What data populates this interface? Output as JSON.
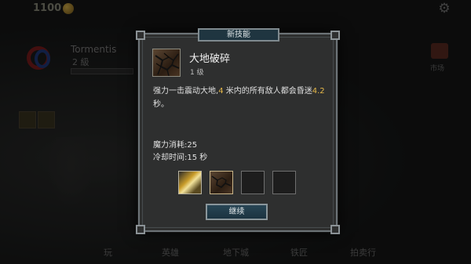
{
  "top": {
    "gold": "1100"
  },
  "hero": {
    "name": "Tormentis",
    "level": "2 級"
  },
  "market": {
    "label": "市场"
  },
  "nav": [
    "玩",
    "英雄",
    "地下城",
    "铁匠",
    "拍卖行"
  ],
  "dialog": {
    "title": "新技能",
    "skill_name": "大地破碎",
    "skill_level": "1 级",
    "desc_a": "强力一击震动大地,",
    "desc_hl1": "4",
    "desc_b": " 米内的所有敌人都会昏迷",
    "desc_hl2": "4.2",
    "desc_c": " 秒。",
    "mana": "魔力消耗:25",
    "cooldown": "冷却时间:15 秒",
    "continue": "继续"
  },
  "colors": {
    "highlight": "#e7b94a",
    "button": "#284655",
    "panel": "#2e2f2f"
  }
}
